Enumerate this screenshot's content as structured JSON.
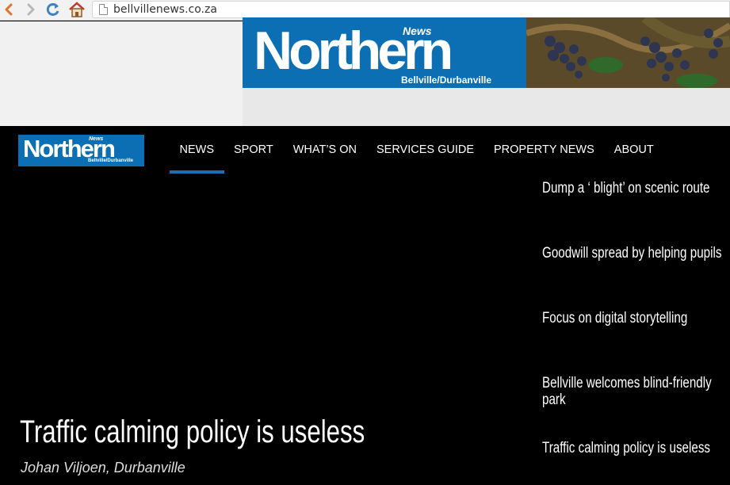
{
  "browser": {
    "url": "bellvillenews.co.za",
    "back_icon": "back-arrow-icon",
    "forward_icon": "forward-arrow-icon",
    "reload_icon": "reload-icon",
    "home_icon": "home-icon"
  },
  "banner": {
    "logo_main": "Northern",
    "logo_news": "News",
    "logo_sub": "Bellville/Durbanville",
    "brand_color": "#0c6fb3"
  },
  "site_logo": {
    "main": "Northern",
    "news": "News",
    "sub": "Bellville/Durbanville"
  },
  "menu": [
    {
      "label": "NEWS",
      "active": true
    },
    {
      "label": "SPORT"
    },
    {
      "label": "WHAT’S ON"
    },
    {
      "label": "SERVICES GUIDE"
    },
    {
      "label": "PROPERTY NEWS"
    },
    {
      "label": "ABOUT"
    }
  ],
  "hero": {
    "title": "Traffic calming policy is useless",
    "author": "Johan Viljoen, Durbanville"
  },
  "side_stories": [
    {
      "title": "Dump a ‘ blight’ on scenic route"
    },
    {
      "title": "Goodwill spread by helping pupils"
    },
    {
      "title": "Focus on digital storytelling"
    },
    {
      "title": "Bellville welcomes blind-friendly park"
    },
    {
      "title": "Traffic calming policy is useless"
    }
  ]
}
